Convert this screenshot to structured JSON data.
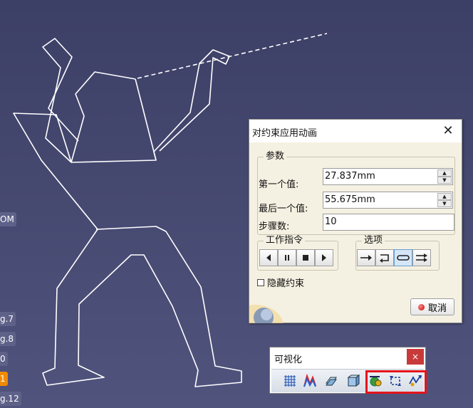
{
  "tree_tags": [
    "OM",
    "g.7",
    "g.8",
    "0",
    "1",
    "g.12"
  ],
  "dialog": {
    "title": "对约束应用动画",
    "params_group": "参数",
    "first_label": "第一个值:",
    "first_value": "27.837mm",
    "last_label": "最后一个值:",
    "last_value": "55.675mm",
    "steps_label": "步骤数:",
    "steps_value": "10",
    "commands_group": "工作指令",
    "options_group": "选项",
    "hide_constraints": "隐藏约束",
    "cancel": "取消"
  },
  "vis_toolbar": {
    "title": "可视化",
    "close": "×"
  },
  "colors": {
    "background": "#45486f",
    "highlight": "#e5141c",
    "active_tag": "#f08a00"
  }
}
